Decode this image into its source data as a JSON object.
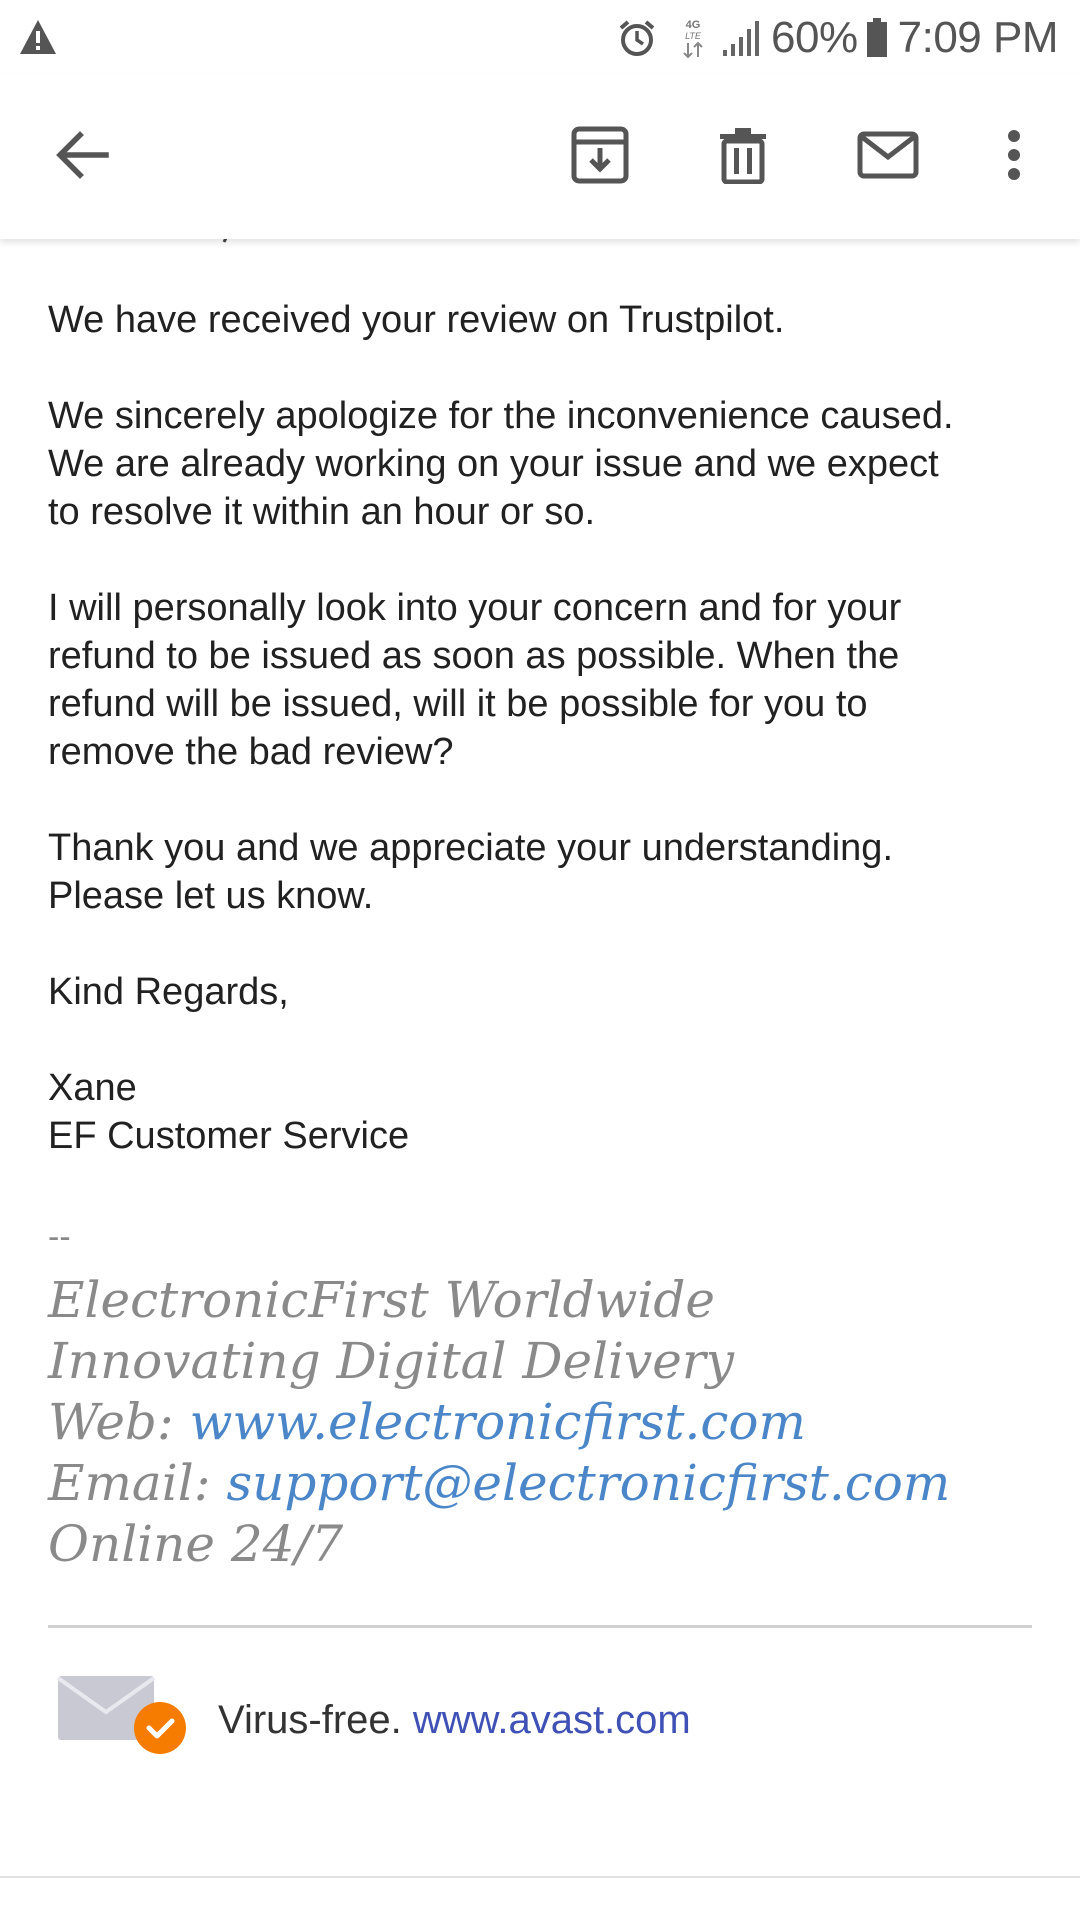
{
  "status_bar": {
    "battery": "60%",
    "time": "7:09 PM",
    "network": "4G LTE",
    "icons": [
      "warning-icon",
      "alarm-icon",
      "lte-icon",
      "signal-icon",
      "battery-icon"
    ]
  },
  "toolbar": {
    "icons": [
      "back-arrow-icon",
      "archive-icon",
      "delete-icon",
      "mark-unread-icon",
      "more-vert-icon"
    ]
  },
  "email": {
    "paragraphs": [
      "We have received your review on Trustpilot.",
      "We sincerely apologize for the inconvenience caused.\nWe are already working on your issue and we expect\nto resolve it within an hour or so.",
      "I will personally look into your concern and for your\nrefund to be issued as soon as possible. When the\nrefund will be issued, will it be possible for you to\nremove the bad review?",
      "Thank you and we appreciate your understanding.\nPlease let us know.",
      "Kind Regards,",
      "Xane\nEF Customer Service"
    ],
    "signature": {
      "separator": "--",
      "company": "ElectronicFirst Worldwide",
      "tagline": "Innovating Digital Delivery",
      "web_label": "Web: ",
      "web_link": "www.electronicfirst.com",
      "email_label": "Email: ",
      "email_link": "support@electronicfirst.com",
      "hours": "Online 24/7"
    },
    "avast": {
      "text": "Virus-free. ",
      "link": "www.avast.com"
    }
  },
  "colors": {
    "link_signature": "#4a86c8",
    "link_avast": "#3f51b5",
    "signature_text": "#8a8a8a",
    "badge_orange": "#f57c00"
  }
}
